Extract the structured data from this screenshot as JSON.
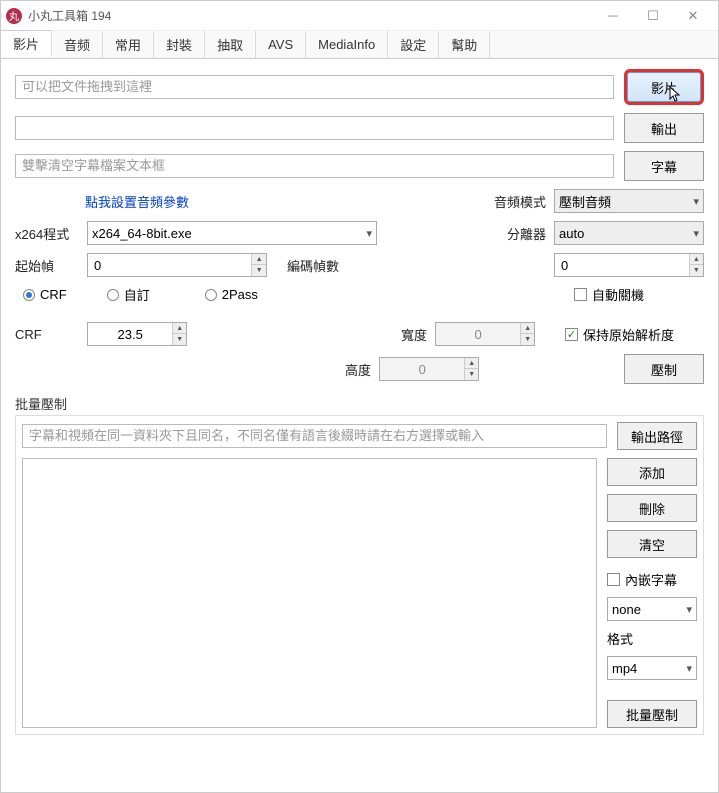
{
  "window": {
    "title": "小丸工具箱 194"
  },
  "tabs": [
    "影片",
    "音频",
    "常用",
    "封裝",
    "抽取",
    "AVS",
    "MediaInfo",
    "設定",
    "幫助"
  ],
  "inputs": {
    "drop_hint": "可以把文件拖拽到這裡",
    "subtitle_hint": "雙擊清空字幕檔案文本框"
  },
  "buttons": {
    "video": "影片",
    "output": "輸出",
    "subtitle": "字幕",
    "encode": "壓制",
    "output_path": "輸出路徑",
    "add": "添加",
    "delete": "刪除",
    "clear": "清空",
    "batch_encode": "批量壓制"
  },
  "labels": {
    "audio_params_link": "點我設置音頻參數",
    "audio_mode": "音頻模式",
    "separator": "分離器",
    "x264_exe": "x264程式",
    "start_frame": "起始幀",
    "encode_frames": "編碼幀數",
    "crf": "CRF",
    "custom": "自訂",
    "twopass": "2Pass",
    "auto_shutdown": "自動關機",
    "width": "寬度",
    "height": "高度",
    "keep_res": "保持原始解析度",
    "batch_title": "批量壓制",
    "batch_hint": "字幕和視頻在同一資料夾下且同名，不同名僅有語言後綴時請在右方選擇或輸入",
    "embed_subtitle": "內嵌字幕",
    "format": "格式"
  },
  "values": {
    "audio_mode": "壓制音頻",
    "separator": "auto",
    "x264_exe": "x264_64-8bit.exe",
    "start_frame": "0",
    "encode_frames": "0",
    "crf": "23.5",
    "width": "0",
    "height": "0",
    "embed_lang": "none",
    "format": "mp4"
  }
}
